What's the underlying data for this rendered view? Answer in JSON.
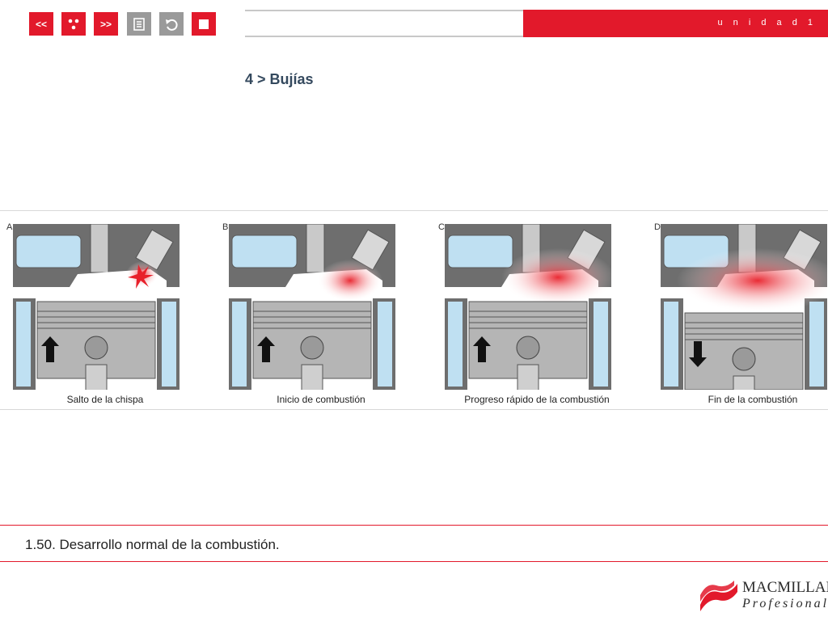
{
  "nav": {
    "prev_label": "<<",
    "next_label": ">>"
  },
  "header": {
    "unit_label": "u n i d a d  1"
  },
  "section_title": "4 > Bujías",
  "figure": {
    "panels": [
      {
        "letter": "A",
        "caption": "Salto de la chispa",
        "piston": "up",
        "flame": "spark"
      },
      {
        "letter": "B",
        "caption": "Inicio de combustión",
        "piston": "up",
        "flame": "start"
      },
      {
        "letter": "C",
        "caption": "Progreso rápido de la combustión",
        "piston": "up",
        "flame": "spread"
      },
      {
        "letter": "D",
        "caption": "Fin de la combustión",
        "piston": "down",
        "flame": "end"
      }
    ]
  },
  "caption": "1.50. Desarrollo normal de la combustión.",
  "logo": {
    "line1": "MACMILLAN",
    "line2": "Profesional"
  },
  "colors": {
    "accent": "#e2192b",
    "water": "#bfe0f2",
    "metal": "#b5b5b5",
    "title": "#34495e"
  }
}
